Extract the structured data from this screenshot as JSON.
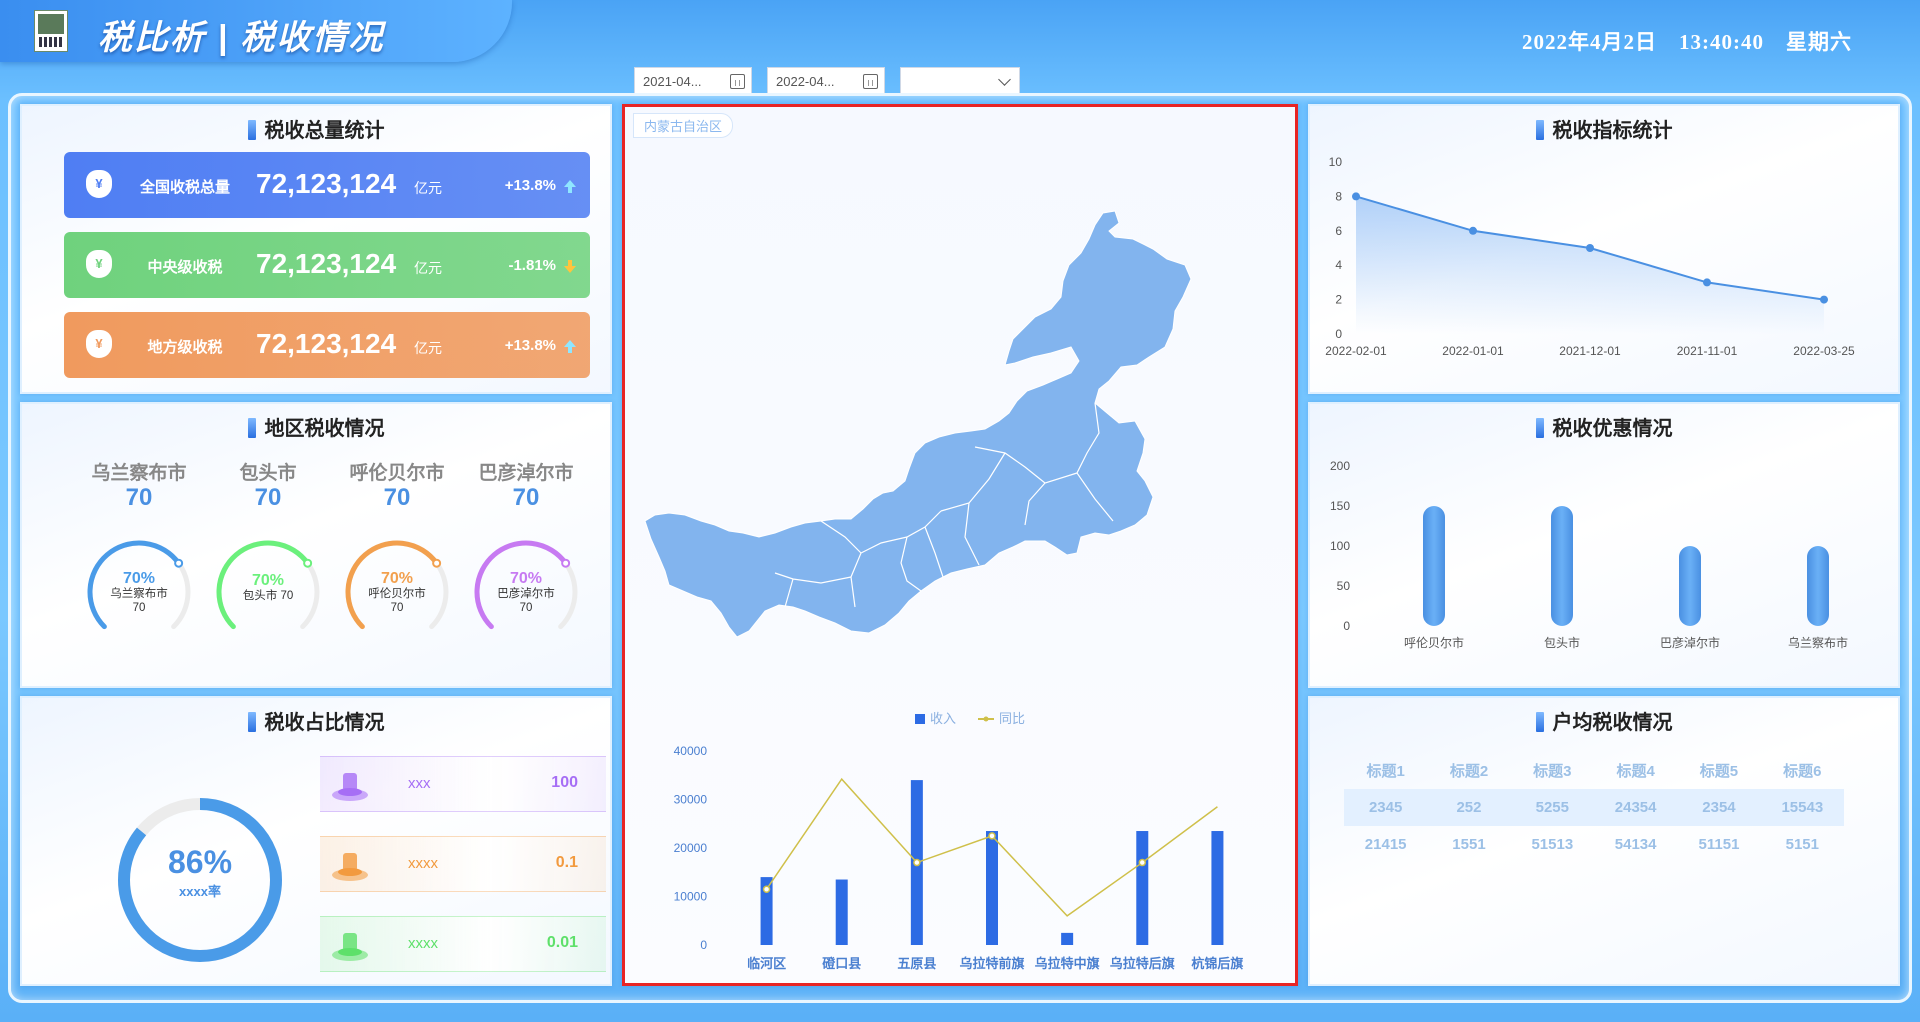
{
  "header": {
    "title": "税比析 | 税收情况",
    "date": "2022年4月2日",
    "time": "13:40:40",
    "weekday": "星期六"
  },
  "filters": {
    "start_date": "2021-04...",
    "end_date": "2022-04...",
    "select_value": ""
  },
  "total_panel": {
    "title": "税收总量统计",
    "rows": [
      {
        "label": "全国收税总量",
        "value": "72,123,124",
        "unit": "亿元",
        "change": "+13.8%",
        "color": "#4f7ef3"
      },
      {
        "label": "中央级收税",
        "value": "72,123,124",
        "unit": "亿元",
        "change": "-1.81%",
        "color": "#6fd27d"
      },
      {
        "label": "地方级收税",
        "value": "72,123,124",
        "unit": "亿元",
        "change": "+13.8%",
        "color": "#f09a5e"
      }
    ]
  },
  "region_panel": {
    "title": "地区税收情况",
    "items": [
      {
        "name": "乌兰察布市",
        "value": "70",
        "pct": "70%",
        "gauge_label": "乌兰察布市",
        "gauge_value": "70",
        "ratio": 0.7,
        "color": "#4a9be8"
      },
      {
        "name": "包头市",
        "value": "70",
        "pct": "70%",
        "gauge_label": "包头市 70",
        "gauge_value": "",
        "ratio": 0.7,
        "color": "#6bf07c"
      },
      {
        "name": "呼伦贝尔市",
        "value": "70",
        "pct": "70%",
        "gauge_label": "呼伦贝尔市",
        "gauge_value": "70",
        "ratio": 0.7,
        "color": "#f2a04e"
      },
      {
        "name": "巴彦淖尔市",
        "value": "70",
        "pct": "70%",
        "gauge_label": "巴彦淖尔市",
        "gauge_value": "70",
        "ratio": 0.7,
        "color": "#c77af2"
      }
    ]
  },
  "ratio_panel": {
    "title": "税收占比情况",
    "donut_value": "86%",
    "donut_ratio": 0.86,
    "donut_label": "xxxx率",
    "rows": [
      {
        "name": "xxx",
        "value": "100",
        "color": "#a66ef5"
      },
      {
        "name": "xxxx",
        "value": "0.1",
        "color": "#f29a3e"
      },
      {
        "name": "xxxx",
        "value": "0.01",
        "color": "#5ee06a"
      }
    ]
  },
  "map_panel": {
    "region_tag": "内蒙古自治区",
    "legend_income": "收入",
    "legend_yoy": "同比"
  },
  "index_panel": {
    "title": "税收指标统计"
  },
  "discount_panel": {
    "title": "税收优惠情况"
  },
  "household_panel": {
    "title": "户均税收情况",
    "headers": [
      "标题1",
      "标题2",
      "标题3",
      "标题4",
      "标题5",
      "标题6"
    ],
    "rows": [
      [
        "2345",
        "252",
        "5255",
        "24354",
        "2354",
        "15543"
      ],
      [
        "21415",
        "1551",
        "51513",
        "54134",
        "51151",
        "5151"
      ]
    ]
  },
  "chart_data": [
    {
      "type": "bar",
      "title": "",
      "categories": [
        "临河区",
        "磴口县",
        "五原县",
        "乌拉特前旗",
        "乌拉特中旗",
        "乌拉特后旗",
        "杭锦后旗"
      ],
      "series": [
        {
          "name": "收入",
          "type": "bar",
          "values": [
            14000,
            13500,
            34000,
            23500,
            2500,
            23500,
            23500
          ]
        },
        {
          "name": "同比",
          "type": "line",
          "values": [
            11500,
            34200,
            17000,
            22500,
            6000,
            17000,
            28500
          ]
        }
      ],
      "yticks": [
        0,
        10000,
        20000,
        30000,
        40000
      ],
      "ylim": [
        0,
        40000
      ],
      "legend": "top-center",
      "grid": false
    },
    {
      "type": "area",
      "title": "",
      "x": [
        "2022-02-01",
        "2022-01-01",
        "2021-12-01",
        "2021-11-01",
        "2022-03-25"
      ],
      "values": [
        8,
        6,
        5,
        3,
        2
      ],
      "yticks": [
        0,
        2,
        4,
        6,
        8,
        10
      ],
      "ylim": [
        0,
        10
      ],
      "grid": false
    },
    {
      "type": "bar",
      "title": "",
      "categories": [
        "呼伦贝尔市",
        "包头市",
        "巴彦淖尔市",
        "乌兰察布市"
      ],
      "values": [
        150,
        150,
        100,
        100
      ],
      "yticks": [
        0,
        50,
        100,
        150,
        200
      ],
      "ylim": [
        0,
        200
      ],
      "grid": false
    }
  ]
}
